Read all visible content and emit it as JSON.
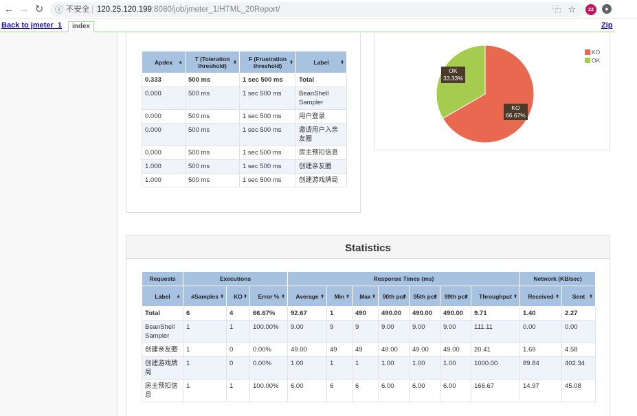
{
  "browser": {
    "info_glyph": "ⓘ",
    "insecure_label": "不安全",
    "separator": "|",
    "url_host": "120.25.120.199",
    "url_path": ":8080/job/jmeter_1/HTML_20Report/",
    "avatar_text": "zz"
  },
  "publisher": {
    "back_link": "Back to jmeter_1",
    "tab_label": "index",
    "zip_link": "Zip"
  },
  "apdex": {
    "headers": [
      "Apdex",
      "T (Toleration threshold)",
      "F (Frustration threshold)",
      "Label"
    ],
    "rows": [
      {
        "apdex": "0.333",
        "t": "500 ms",
        "f": "1 sec 500 ms",
        "label": "Total"
      },
      {
        "apdex": "0.000",
        "t": "500 ms",
        "f": "1 sec 500 ms",
        "label": "BeanShell Sampler"
      },
      {
        "apdex": "0.000",
        "t": "500 ms",
        "f": "1 sec 500 ms",
        "label": "用户登录"
      },
      {
        "apdex": "0.000",
        "t": "500 ms",
        "f": "1 sec 500 ms",
        "label": "邀请用户入亲友圈"
      },
      {
        "apdex": "0.000",
        "t": "500 ms",
        "f": "1 sec 500 ms",
        "label": "房主预扣信息"
      },
      {
        "apdex": "1.000",
        "t": "500 ms",
        "f": "1 sec 500 ms",
        "label": "创建亲友圈"
      },
      {
        "apdex": "1.000",
        "t": "500 ms",
        "f": "1 sec 500 ms",
        "label": "创建游戏牌局"
      }
    ]
  },
  "pie": {
    "slices": [
      {
        "name": "KO",
        "percent": 66.67,
        "label": "KO\n66.67%",
        "color": "#e8694f"
      },
      {
        "name": "OK",
        "percent": 33.33,
        "label": "OK\n33.33%",
        "color": "#a6cc4f"
      }
    ],
    "legend": [
      "KO",
      "OK"
    ]
  },
  "stats": {
    "title": "Statistics",
    "groups": [
      "Requests",
      "Executions",
      "Response Times (ms)",
      "Network (KB/sec)"
    ],
    "columns": [
      "Label",
      "#Samples",
      "KO",
      "Error %",
      "Average",
      "Min",
      "Max",
      "90th pct",
      "95th pct",
      "99th pct",
      "Throughput",
      "Received",
      "Sent"
    ],
    "rows": [
      [
        "Total",
        "6",
        "4",
        "66.67%",
        "92.67",
        "1",
        "490",
        "490.00",
        "490.00",
        "490.00",
        "9.71",
        "1.40",
        "2.27"
      ],
      [
        "BeanShell Sampler",
        "1",
        "1",
        "100.00%",
        "9.00",
        "9",
        "9",
        "9.00",
        "9.00",
        "9.00",
        "111.11",
        "0.00",
        "0.00"
      ],
      [
        "创建亲友圈",
        "1",
        "0",
        "0.00%",
        "49.00",
        "49",
        "49",
        "49.00",
        "49.00",
        "49.00",
        "20.41",
        "1.69",
        "4.58"
      ],
      [
        "创建游戏牌局",
        "1",
        "0",
        "0.00%",
        "1.00",
        "1",
        "1",
        "1.00",
        "1.00",
        "1.00",
        "1000.00",
        "89.84",
        "402.34"
      ],
      [
        "房主预扣信息",
        "1",
        "1",
        "100.00%",
        "6.00",
        "6",
        "6",
        "6.00",
        "6.00",
        "6.00",
        "166.67",
        "14.97",
        "45.08"
      ]
    ]
  },
  "colors": {
    "header_blue": "#a7c1e0",
    "ko": "#e8694f",
    "ok": "#a6cc4f",
    "link": "#1a0dab"
  }
}
